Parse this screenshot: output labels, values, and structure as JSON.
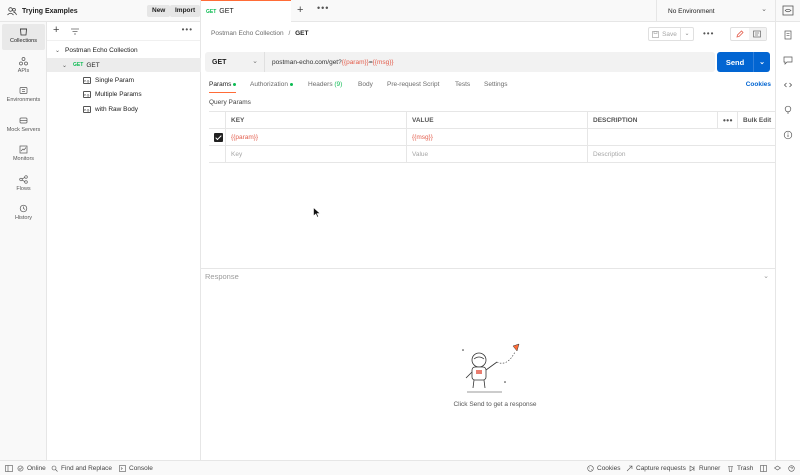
{
  "header": {
    "workspace_name": "Trying Examples",
    "new_label": "New",
    "import_label": "Import",
    "active_tab": {
      "method": "GET",
      "name": "GET"
    },
    "environment": "No Environment"
  },
  "nav": [
    {
      "label": "Collections",
      "icon": "collections-icon",
      "active": true
    },
    {
      "label": "APIs",
      "icon": "apis-icon"
    },
    {
      "label": "Environments",
      "icon": "environments-icon"
    },
    {
      "label": "Mock Servers",
      "icon": "mock-servers-icon"
    },
    {
      "label": "Monitors",
      "icon": "monitors-icon"
    },
    {
      "label": "Flows",
      "icon": "flows-icon"
    },
    {
      "label": "History",
      "icon": "history-icon"
    }
  ],
  "sidebar": {
    "collection": "Postman Echo Collection",
    "folder": {
      "method": "GET",
      "name": "GET"
    },
    "examples": [
      "Single Param",
      "Multiple Params",
      "with Raw Body"
    ],
    "example_icon_text": "e.g."
  },
  "request": {
    "breadcrumb_parent": "Postman Echo Collection",
    "breadcrumb_sep": "/",
    "breadcrumb_current": "GET",
    "save_label": "Save",
    "method": "GET",
    "url_base": "postman-echo.com/get?",
    "url_var1": "{{param}}",
    "url_eq": "=",
    "url_var2": "{{msg}}",
    "send_label": "Send",
    "tabs": {
      "params": "Params",
      "authorization": "Authorization",
      "headers": "Headers",
      "headers_count": "(9)",
      "body": "Body",
      "prerequest": "Pre-request Script",
      "tests": "Tests",
      "settings": "Settings"
    },
    "cookies_label": "Cookies",
    "query_params_label": "Query Params",
    "table": {
      "headers": {
        "key": "KEY",
        "value": "VALUE",
        "description": "DESCRIPTION",
        "bulk": "Bulk Edit"
      },
      "row": {
        "key": "{{param}}",
        "value": "{{msg}}",
        "description": ""
      },
      "placeholders": {
        "key": "Key",
        "value": "Value",
        "description": "Description"
      }
    }
  },
  "response": {
    "title": "Response",
    "empty_text": "Click Send to get a response"
  },
  "statusbar": {
    "online": "Online",
    "find_replace": "Find and Replace",
    "console": "Console",
    "cookies": "Cookies",
    "capture": "Capture requests",
    "runner": "Runner",
    "trash": "Trash"
  },
  "colors": {
    "accent": "#ff6c37",
    "send": "#0265d2",
    "get": "#0cbb52",
    "variable": "#e35d4c"
  }
}
